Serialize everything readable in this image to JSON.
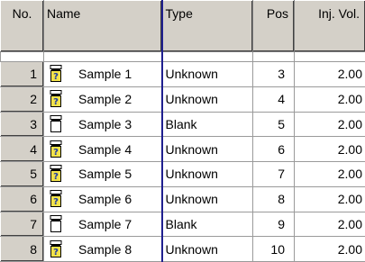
{
  "columns": {
    "no": "No.",
    "name": "Name",
    "type": "Type",
    "pos": "Pos",
    "inj_vol": "Inj. Vol."
  },
  "rows": [
    {
      "no": "1",
      "name": "Sample 1",
      "icon": "vial-unknown-icon",
      "type": "Unknown",
      "pos": "3",
      "vol": "2.00"
    },
    {
      "no": "2",
      "name": "Sample 2",
      "icon": "vial-unknown-icon",
      "type": "Unknown",
      "pos": "4",
      "vol": "2.00"
    },
    {
      "no": "3",
      "name": "Sample 3",
      "icon": "vial-blank-icon",
      "type": "Blank",
      "pos": "5",
      "vol": "2.00"
    },
    {
      "no": "4",
      "name": "Sample 4",
      "icon": "vial-unknown-icon",
      "type": "Unknown",
      "pos": "6",
      "vol": "2.00"
    },
    {
      "no": "5",
      "name": "Sample 5",
      "icon": "vial-unknown-icon",
      "type": "Unknown",
      "pos": "7",
      "vol": "2.00"
    },
    {
      "no": "6",
      "name": "Sample 6",
      "icon": "vial-unknown-icon",
      "type": "Unknown",
      "pos": "8",
      "vol": "2.00"
    },
    {
      "no": "7",
      "name": "Sample 7",
      "icon": "vial-blank-icon",
      "type": "Blank",
      "pos": "9",
      "vol": "2.00"
    },
    {
      "no": "8",
      "name": "Sample 8",
      "icon": "vial-unknown-icon",
      "type": "Unknown",
      "pos": "10",
      "vol": "2.00"
    }
  ],
  "colors": {
    "header_bg": "#d4d0c8",
    "type_divider": "#1f1f8f",
    "vial_unknown_fill": "#f2e24a",
    "vial_blank_fill": "#ffffff"
  }
}
